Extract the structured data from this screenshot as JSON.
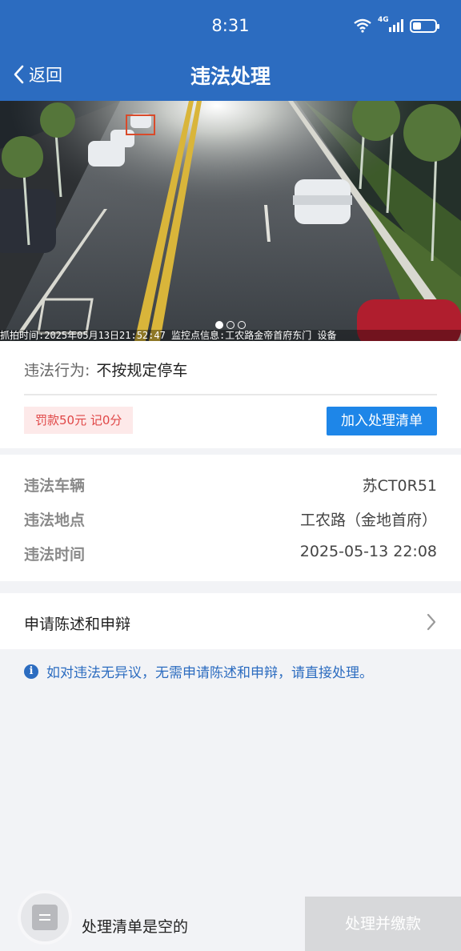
{
  "status_bar": {
    "time": "8:31",
    "network": "4G",
    "icons": [
      "wifi-icon",
      "signal-icon",
      "battery-icon"
    ]
  },
  "nav": {
    "back_label": "返回",
    "title": "违法处理"
  },
  "photo": {
    "stamp_text": "抓拍时间:2025年05月13日21:52:47 监控点信息:工农路金帝首府东门 设备",
    "page_count": 3,
    "active_page": 1
  },
  "violation": {
    "behavior_label": "违法行为:",
    "behavior_value": "不按规定停车",
    "fine_badge": "罚款50元 记0分",
    "add_button": "加入处理清单"
  },
  "details": [
    {
      "label": "违法车辆",
      "value": "苏CT0R51"
    },
    {
      "label": "违法地点",
      "value": "工农路（金地首府）"
    },
    {
      "label": "违法时间",
      "value": "2025-05-13 22:08"
    }
  ],
  "appeal": {
    "label": "申请陈述和申辩"
  },
  "notice": {
    "text": "如对违法无异议，无需申请陈述和申辩，请直接处理。"
  },
  "bottom": {
    "cart_empty_text": "处理清单是空的",
    "pay_button": "处理并缴款"
  },
  "colors": {
    "brand_blue": "#2c6cc0",
    "button_blue": "#1e86e8",
    "fine_red": "#e04646",
    "disabled_gray": "#d7d8da"
  }
}
